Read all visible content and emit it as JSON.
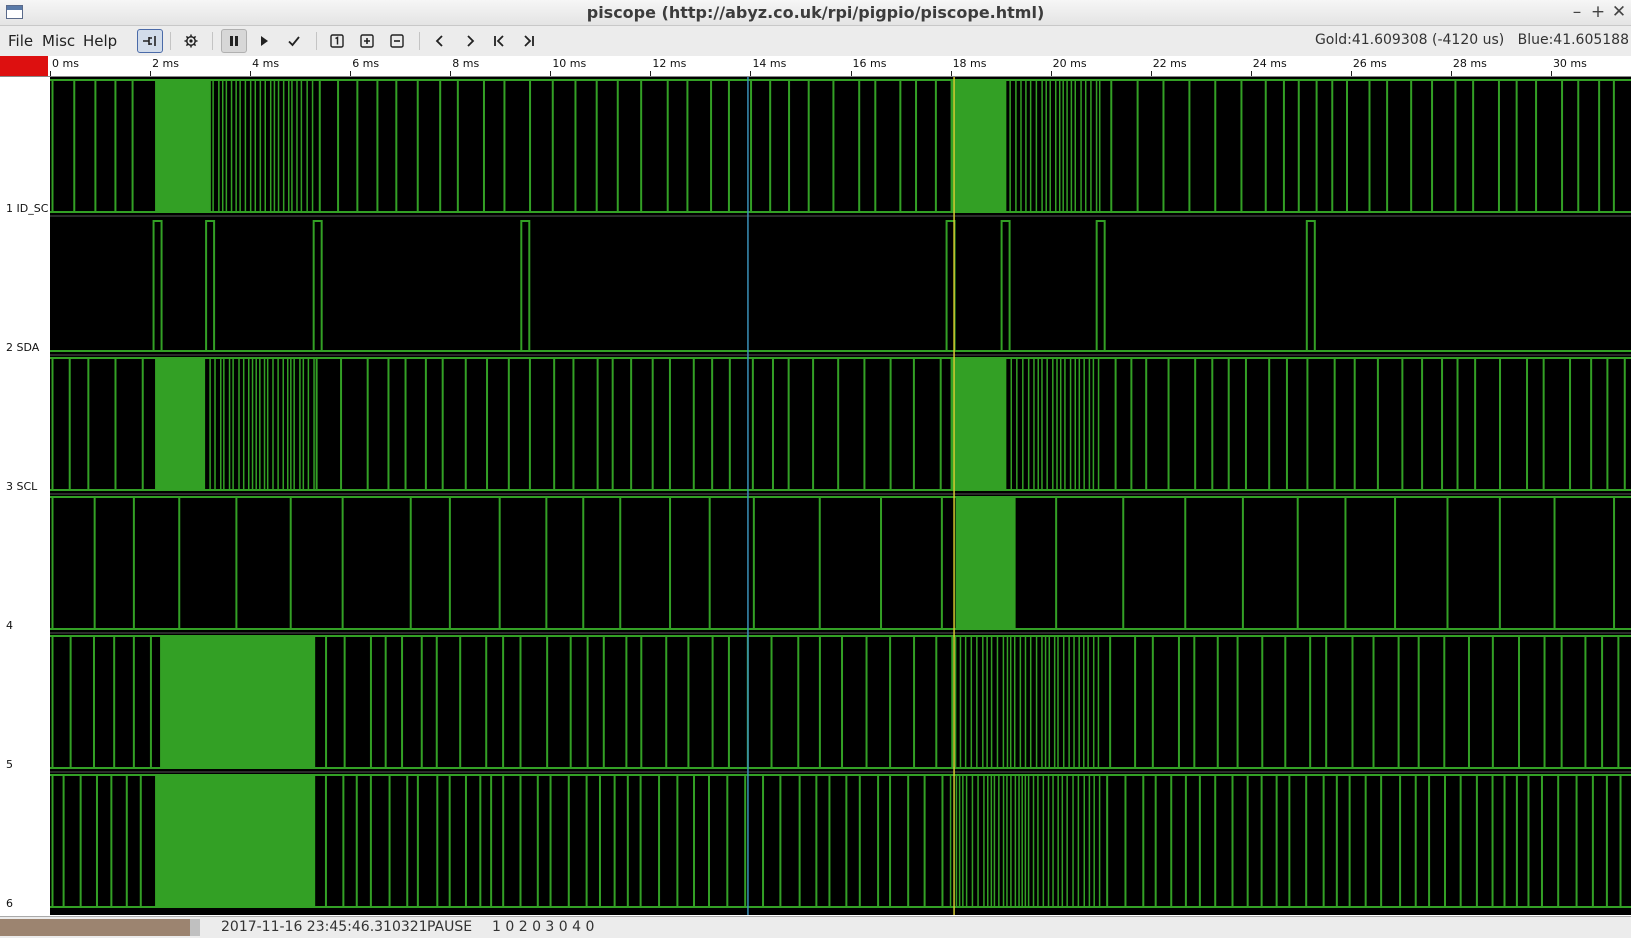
{
  "window": {
    "title": "piscope (http://abyz.co.uk/rpi/pigpio/piscope.html)",
    "controls": {
      "minimize": "–",
      "maximize": "+",
      "close": "✕"
    }
  },
  "menu": {
    "file": "File",
    "misc": "Misc",
    "help": "Help"
  },
  "toolbar": {
    "buttons": [
      {
        "name": "connect",
        "icon": "plug-icon",
        "state": "active"
      },
      {
        "name": "settings",
        "icon": "gear-icon"
      },
      {
        "name": "pause",
        "icon": "pause-icon",
        "state": "pressed"
      },
      {
        "name": "play",
        "icon": "play-icon"
      },
      {
        "name": "trigger",
        "icon": "check-icon"
      },
      {
        "name": "zoom-one",
        "icon": "zoom-one-icon"
      },
      {
        "name": "zoom-in",
        "icon": "zoom-in-icon"
      },
      {
        "name": "zoom-out",
        "icon": "zoom-out-icon"
      },
      {
        "name": "scroll-left",
        "icon": "chevron-left-icon"
      },
      {
        "name": "scroll-right",
        "icon": "chevron-right-icon"
      },
      {
        "name": "go-start",
        "icon": "skip-start-icon"
      },
      {
        "name": "go-end",
        "icon": "skip-end-icon"
      }
    ]
  },
  "readout": {
    "gold": "Gold:41.609308 (-4120 us)",
    "blue": "Blue:41.605188"
  },
  "ruler": {
    "ticks": [
      "0 ms",
      "2 ms",
      "4 ms",
      "6 ms",
      "8 ms",
      "10 ms",
      "12 ms",
      "14 ms",
      "16 ms",
      "18 ms",
      "20 ms",
      "22 ms",
      "24 ms",
      "26 ms",
      "28 ms",
      "30 ms"
    ],
    "tick_ms": [
      0,
      2,
      4,
      6,
      8,
      10,
      12,
      14,
      16,
      18,
      20,
      22,
      24,
      26,
      28,
      30
    ],
    "visible_range_ms": [
      0,
      31.6
    ]
  },
  "channels": [
    {
      "label": "1 ID_SC"
    },
    {
      "label": "2 SDA"
    },
    {
      "label": "3 SCL"
    },
    {
      "label": "4"
    },
    {
      "label": "5"
    },
    {
      "label": "6"
    }
  ],
  "markers": {
    "blue_ms": 13.95,
    "gold_ms": 18.07
  },
  "colors": {
    "trace": "#33a025",
    "background": "#000000",
    "blue_marker": "#3a8fb8",
    "gold_marker": "#d2c830",
    "ruler_corner": "#dd1010"
  },
  "status": {
    "timestamp": "2017-11-16 23:45:46.310321",
    "mode": "PAUSE",
    "levels": "1 0  2 0  3 0  4 0"
  }
}
